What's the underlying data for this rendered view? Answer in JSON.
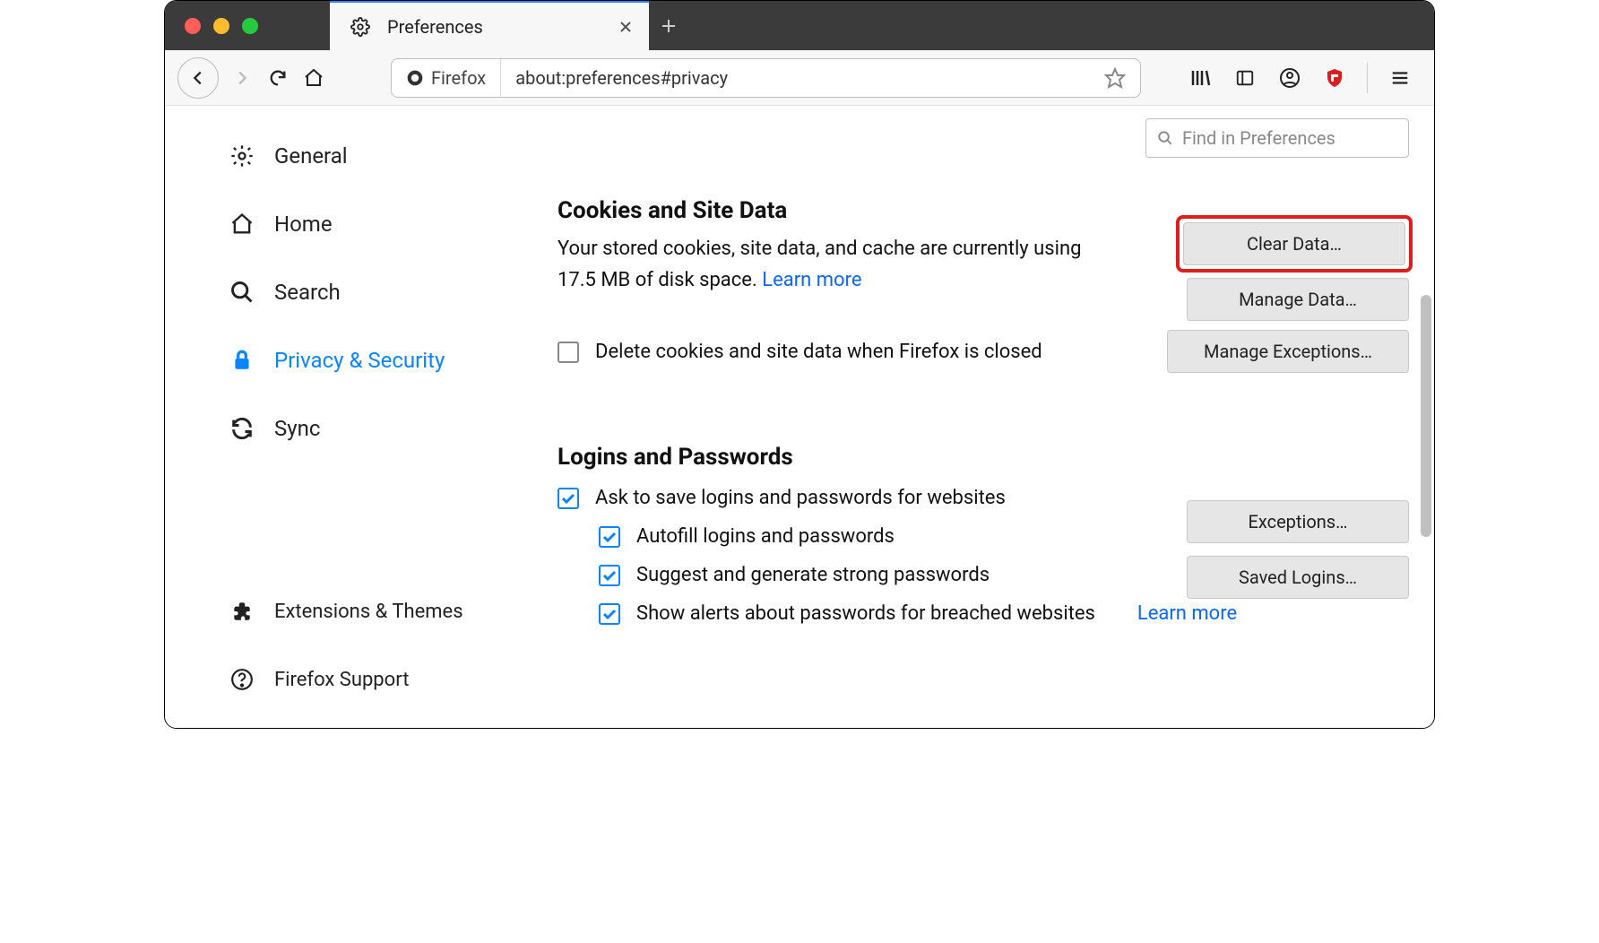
{
  "tab": {
    "title": "Preferences"
  },
  "url": {
    "identity_label": "Firefox",
    "address": "about:preferences#privacy"
  },
  "search": {
    "placeholder": "Find in Preferences"
  },
  "sidebar": {
    "items": [
      {
        "label": "General"
      },
      {
        "label": "Home"
      },
      {
        "label": "Search"
      },
      {
        "label": "Privacy & Security"
      },
      {
        "label": "Sync"
      }
    ],
    "bottom": [
      {
        "label": "Extensions & Themes"
      },
      {
        "label": "Firefox Support"
      }
    ]
  },
  "cookies": {
    "heading": "Cookies and Site Data",
    "desc_prefix": "Your stored cookies, site data, and cache are currently using 17.5 MB of disk space.  ",
    "learn_more": "Learn more",
    "delete_on_close": "Delete cookies and site data when Firefox is closed",
    "buttons": {
      "clear": "Clear Data…",
      "manage": "Manage Data…",
      "exceptions": "Manage Exceptions…"
    }
  },
  "logins": {
    "heading": "Logins and Passwords",
    "ask_save": "Ask to save logins and passwords for websites",
    "autofill": "Autofill logins and passwords",
    "suggest": "Suggest and generate strong passwords",
    "breach": "Show alerts about passwords for breached websites",
    "learn_more": "Learn more",
    "buttons": {
      "exceptions": "Exceptions…",
      "saved": "Saved Logins…"
    }
  }
}
